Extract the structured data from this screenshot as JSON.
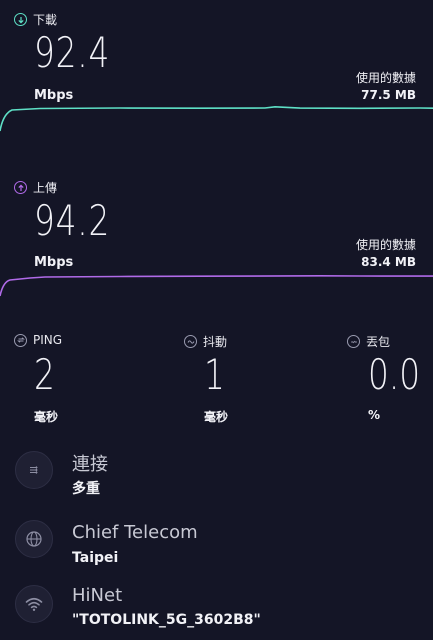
{
  "download": {
    "label": "下載",
    "value": "92.4",
    "unit": "Mbps",
    "data_used_label": "使用的數據",
    "data_used_value": "77.5 MB",
    "color": "#5ee0c6"
  },
  "upload": {
    "label": "上傳",
    "value": "94.2",
    "unit": "Mbps",
    "data_used_label": "使用的數據",
    "data_used_value": "83.4 MB",
    "color": "#b06ae8"
  },
  "stats": {
    "ping": {
      "label": "PING",
      "value": "2",
      "unit": "毫秒",
      "icon": "ping-icon"
    },
    "jitter": {
      "label": "抖動",
      "value": "1",
      "unit": "毫秒",
      "icon": "jitter-icon"
    },
    "loss": {
      "label": "丟包",
      "value": "0.0",
      "unit": "%",
      "icon": "loss-icon"
    }
  },
  "connections": {
    "title": "連接",
    "subtitle": "多重",
    "icon": "connections-icon"
  },
  "server": {
    "title": "Chief Telecom",
    "subtitle": "Taipei",
    "icon": "globe-icon"
  },
  "provider": {
    "title": "HiNet",
    "subtitle": "\"TOTOLINK_5G_3602B8\"",
    "icon": "wifi-icon"
  }
}
